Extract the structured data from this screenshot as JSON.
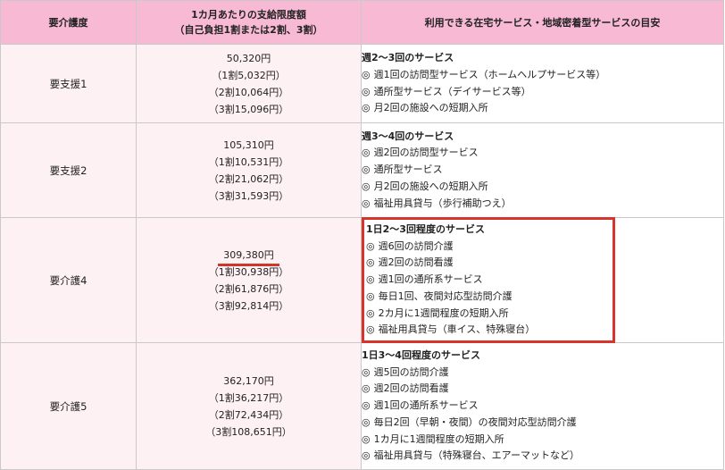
{
  "headers": {
    "level": "要介護度",
    "limit_line1": "1カ月あたりの支給限度額",
    "limit_line2": "（自己負担1割または2割、3割）",
    "services": "利用できる在宅サービス・地域密着型サービスの目安"
  },
  "rows": [
    {
      "level": "要支援1",
      "amount": "50,320円",
      "ratios": [
        "（1割5,032円）",
        "（2割10,064円）",
        "（3割15,096円）"
      ],
      "heading": "週2〜3回のサービス",
      "items": [
        "週1回の訪問型サービス（ホームヘルプサービス等）",
        "通所型サービス（デイサービス等）",
        "月2回の施設への短期入所"
      ]
    },
    {
      "level": "要支援2",
      "amount": "105,310円",
      "ratios": [
        "（1割10,531円）",
        "（2割21,062円）",
        "（3割31,593円）"
      ],
      "heading": "週3〜4回のサービス",
      "items": [
        "週2回の訪問型サービス",
        "通所型サービス",
        "月2回の施設への短期入所",
        "福祉用具貸与（歩行補助つえ）"
      ]
    },
    {
      "level": "要介護4",
      "amount": "309,380円",
      "ratios": [
        "（1割30,938円）",
        "（2割61,876円）",
        "（3割92,814円）"
      ],
      "heading": "1日2〜3回程度のサービス",
      "items": [
        "週6回の訪問介護",
        "週2回の訪問看護",
        "週1回の通所系サービス",
        "毎日1回、夜間対応型訪問介護",
        "2カ月に1週間程度の短期入所",
        "福祉用具貸与（車イス、特殊寝台）"
      ]
    },
    {
      "level": "要介護5",
      "amount": "362,170円",
      "ratios": [
        "（1割36,217円）",
        "（2割72,434円）",
        "（3割108,651円）"
      ],
      "heading": "1日3〜4回程度のサービス",
      "items": [
        "週5回の訪問介護",
        "週2回の訪問看護",
        "週1回の通所系サービス",
        "毎日2回（早朝・夜間）の夜間対応型訪問介護",
        "1カ月に1週間程度の短期入所",
        "福祉用具貸与（特殊寝台、エアーマットなど）"
      ]
    }
  ],
  "highlight_color": "#d8342b",
  "header_bg": "#f7b9d4",
  "cell_bg": "#fdf1f4"
}
